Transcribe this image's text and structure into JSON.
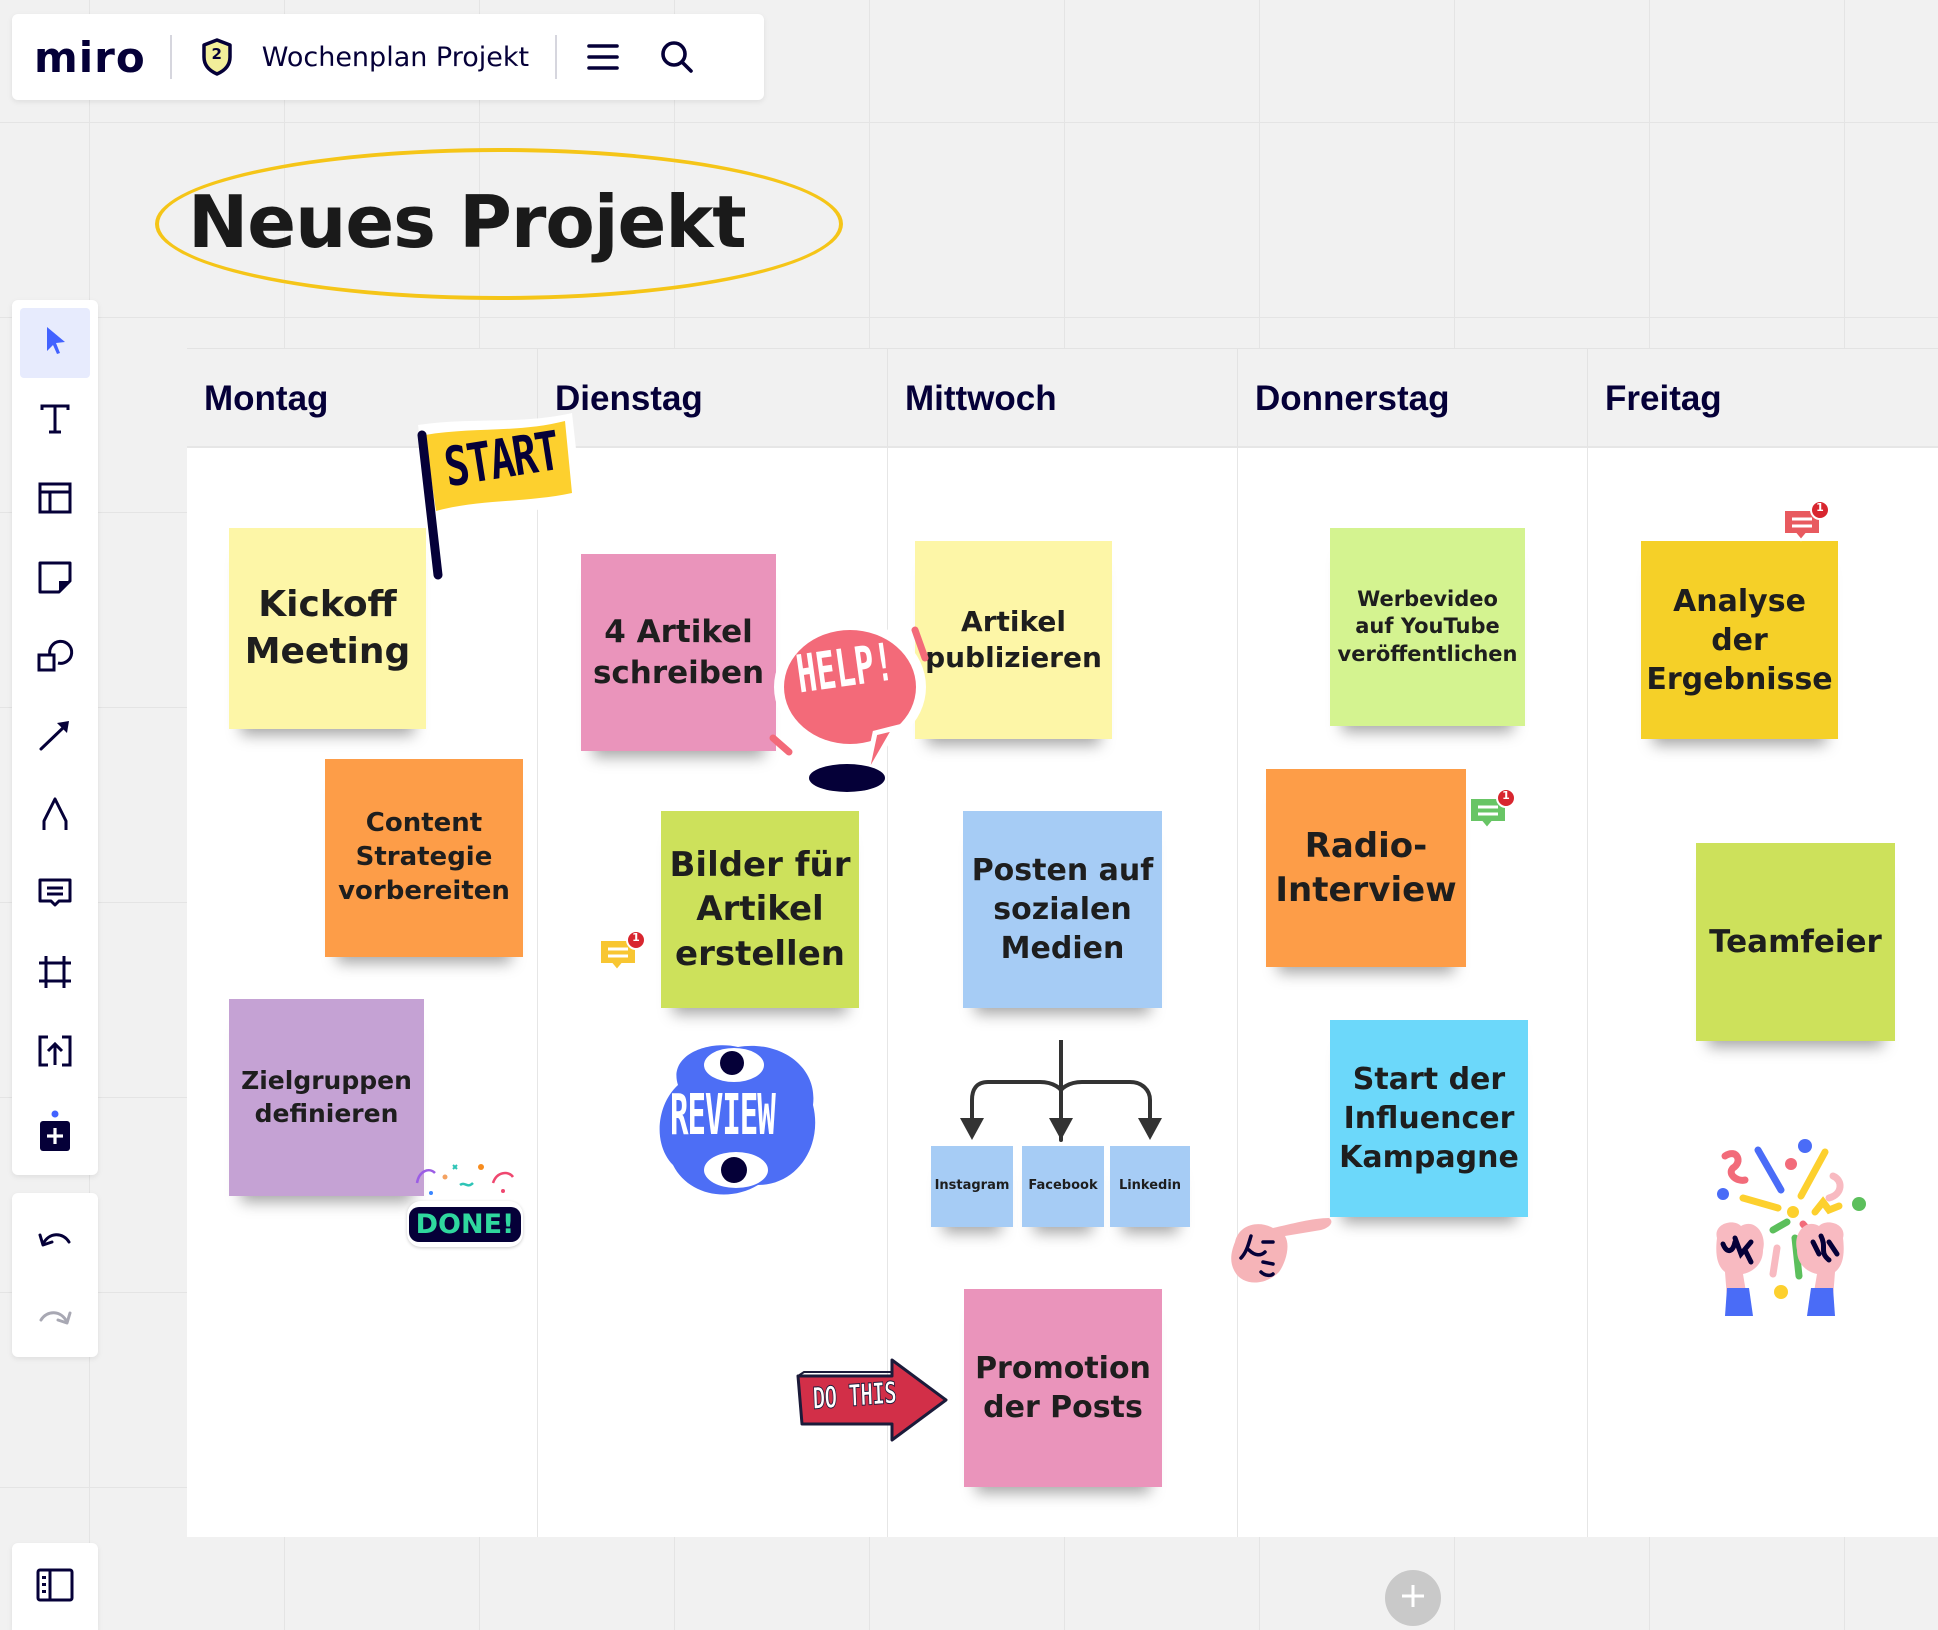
{
  "topbar": {
    "logo": "miro",
    "plan_badge_number": "2",
    "board_name": "Wochenplan Projekt",
    "icons": [
      "shield-badge-icon",
      "menu-icon",
      "search-icon"
    ]
  },
  "title": "Neues Projekt",
  "toolbar": {
    "tools": [
      {
        "name": "select",
        "icon": "cursor-icon",
        "active": true
      },
      {
        "name": "text",
        "icon": "text-icon"
      },
      {
        "name": "templates",
        "icon": "templates-icon"
      },
      {
        "name": "sticky-note",
        "icon": "sticky-note-icon"
      },
      {
        "name": "shapes",
        "icon": "shapes-icon"
      },
      {
        "name": "connection-line",
        "icon": "arrow-icon"
      },
      {
        "name": "pen",
        "icon": "pen-icon"
      },
      {
        "name": "comment",
        "icon": "comment-icon"
      },
      {
        "name": "frame",
        "icon": "frame-icon"
      },
      {
        "name": "upload",
        "icon": "upload-icon"
      },
      {
        "name": "more-apps",
        "icon": "add-apps-icon"
      }
    ],
    "undo_icon": "undo-icon",
    "redo_icon": "redo-icon",
    "panel_icon": "sidebar-panel-icon"
  },
  "columns": [
    "Montag",
    "Dienstag",
    "Mittwoch",
    "Donnerstag",
    "Freitag"
  ],
  "stickies": {
    "kickoff": "Kickoff\nMeeting",
    "content": "Content\nStrategie\nvorbereiten",
    "zielgruppen": "Zielgruppen\ndefinieren",
    "artikel_schreiben": "4 Artikel\nschreiben",
    "bilder": "Bilder für\nArtikel\nerstellen",
    "artikel_publizieren": "Artikel\npublizieren",
    "posten": "Posten auf\nsozialen\nMedien",
    "instagram": "Instagram",
    "facebook": "Facebook",
    "linkedin": "Linkedin",
    "promotion": "Promotion\nder Posts",
    "werbevideo": "Werbevideo\nauf YouTube\nveröffentlichen",
    "radio": "Radio-\nInterview",
    "influencer": "Start der\nInfluencer\nKampagne",
    "analyse": "Analyse\nder\nErgebnisse",
    "teamfeier": "Teamfeier"
  },
  "sticky_colors": {
    "light_yellow": "#fdf6a7",
    "orange": "#fd9d48",
    "violet": "#c5a2d4",
    "pink": "#ea94bb",
    "lime": "#cde15b",
    "light_blue": "#a6ccf5",
    "light_green": "#d4f390",
    "cyan": "#6cd8fa",
    "yellow": "#f5d028"
  },
  "stickers": {
    "start": "START",
    "help": "HELP!",
    "review": "REVIEW",
    "done": "DONE!",
    "do_this": "DO THIS"
  },
  "comments": [
    {
      "target": "Bilder für Artikel erstellen",
      "count": "1",
      "color": "#f8c632"
    },
    {
      "target": "Radio-Interview",
      "count": "1",
      "color": "#68c565"
    },
    {
      "target": "Analyse der Ergebnisse",
      "count": "1",
      "color": "#e85a5f"
    }
  ],
  "add_button_icon": "plus-icon"
}
